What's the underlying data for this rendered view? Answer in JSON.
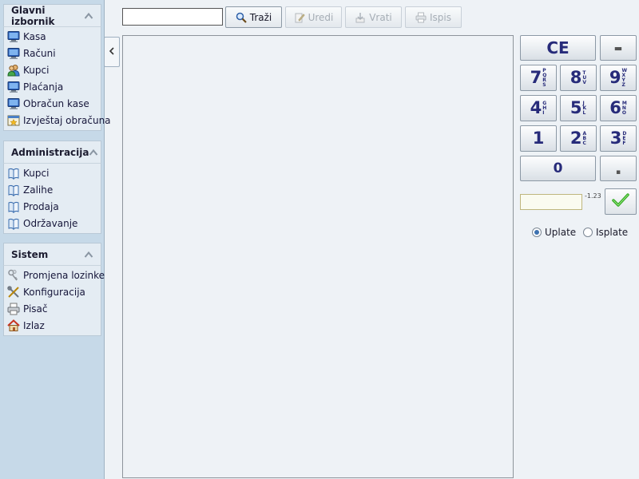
{
  "sidebar": {
    "main_menu": {
      "title": "Glavni izbornik",
      "items": [
        {
          "label": "Kasa",
          "icon": "computer-icon"
        },
        {
          "label": "Računi",
          "icon": "computer-icon"
        },
        {
          "label": "Kupci",
          "icon": "users-icon"
        },
        {
          "label": "Plaćanja",
          "icon": "computer-icon"
        },
        {
          "label": "Obračun kase",
          "icon": "computer-icon"
        },
        {
          "label": "Izvještaj obračuna",
          "icon": "report-icon"
        }
      ]
    },
    "administration": {
      "title": "Administracija",
      "items": [
        {
          "label": "Kupci",
          "icon": "book-icon"
        },
        {
          "label": "Zalihe",
          "icon": "book-icon"
        },
        {
          "label": "Prodaja",
          "icon": "book-icon"
        },
        {
          "label": "Održavanje",
          "icon": "book-icon"
        }
      ]
    },
    "system": {
      "title": "Sistem",
      "items": [
        {
          "label": "Promjena lozinke",
          "icon": "keys-icon"
        },
        {
          "label": "Konfiguracija",
          "icon": "tools-icon"
        },
        {
          "label": "Pisač",
          "icon": "printer-icon"
        },
        {
          "label": "Izlaz",
          "icon": "home-icon"
        }
      ]
    }
  },
  "toolbar": {
    "search_value": "",
    "search_label": "Traži",
    "edit_label": "Uredi",
    "return_label": "Vrati",
    "print_label": "Ispis"
  },
  "keypad": {
    "ce": "CE",
    "minus": "▬",
    "keys": [
      {
        "digit": "7",
        "letters": [
          "P",
          "Q",
          "R",
          "S"
        ]
      },
      {
        "digit": "8",
        "letters": [
          "T",
          "U",
          "V"
        ]
      },
      {
        "digit": "9",
        "letters": [
          "W",
          "X",
          "Y",
          "Z"
        ]
      },
      {
        "digit": "4",
        "letters": [
          "G",
          "H",
          "I"
        ]
      },
      {
        "digit": "5",
        "letters": [
          "J",
          "K",
          "L"
        ]
      },
      {
        "digit": "6",
        "letters": [
          "M",
          "N",
          "O"
        ]
      },
      {
        "digit": "1",
        "letters": []
      },
      {
        "digit": "2",
        "letters": [
          "A",
          "B",
          "C"
        ]
      },
      {
        "digit": "3",
        "letters": [
          "D",
          "E",
          "F"
        ]
      }
    ],
    "zero": "0",
    "decimal": "▪",
    "amount_value": "",
    "amount_hint": "-1.23"
  },
  "payment_type": {
    "options": [
      {
        "label": "Uplate",
        "checked": true
      },
      {
        "label": "Isplate",
        "checked": false
      }
    ]
  },
  "colors": {
    "sidebar_bg": "#c6d9e8",
    "panel_bg": "#e4ecf3",
    "key_text": "#272b7a",
    "confirm_check": "#2ea81c"
  }
}
